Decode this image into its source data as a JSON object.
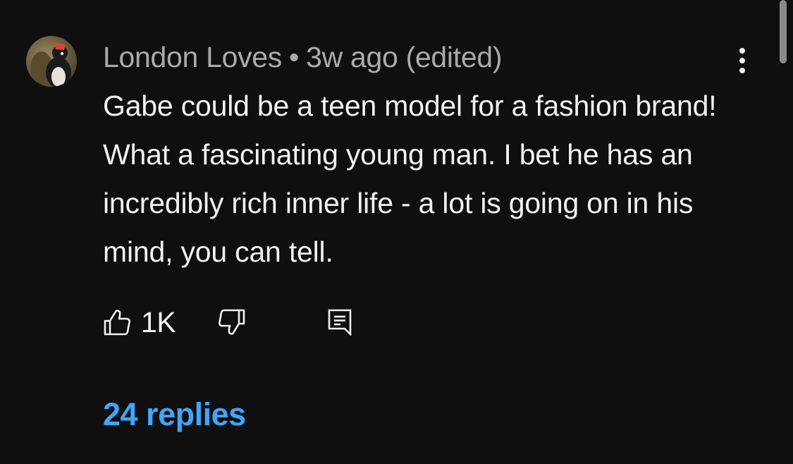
{
  "comment": {
    "author": "London Loves",
    "separator": "•",
    "time": "3w ago (edited)",
    "text": "Gabe could be a teen model for a fashion brand! What a fascinating young man. I bet he has an incredibly rich inner life - a lot is going on in his mind, you can tell.",
    "like_count": "1K",
    "replies_label": "24 replies"
  },
  "icons": {
    "avatar": "avatar-image",
    "more": "more-vertical-icon",
    "like": "thumbs-up-icon",
    "dislike": "thumbs-down-icon",
    "reply": "comment-reply-icon"
  },
  "colors": {
    "background": "#0f0f0f",
    "text_primary": "#f1f1f1",
    "text_secondary": "#aaaaaa",
    "link": "#3ea6ff"
  }
}
